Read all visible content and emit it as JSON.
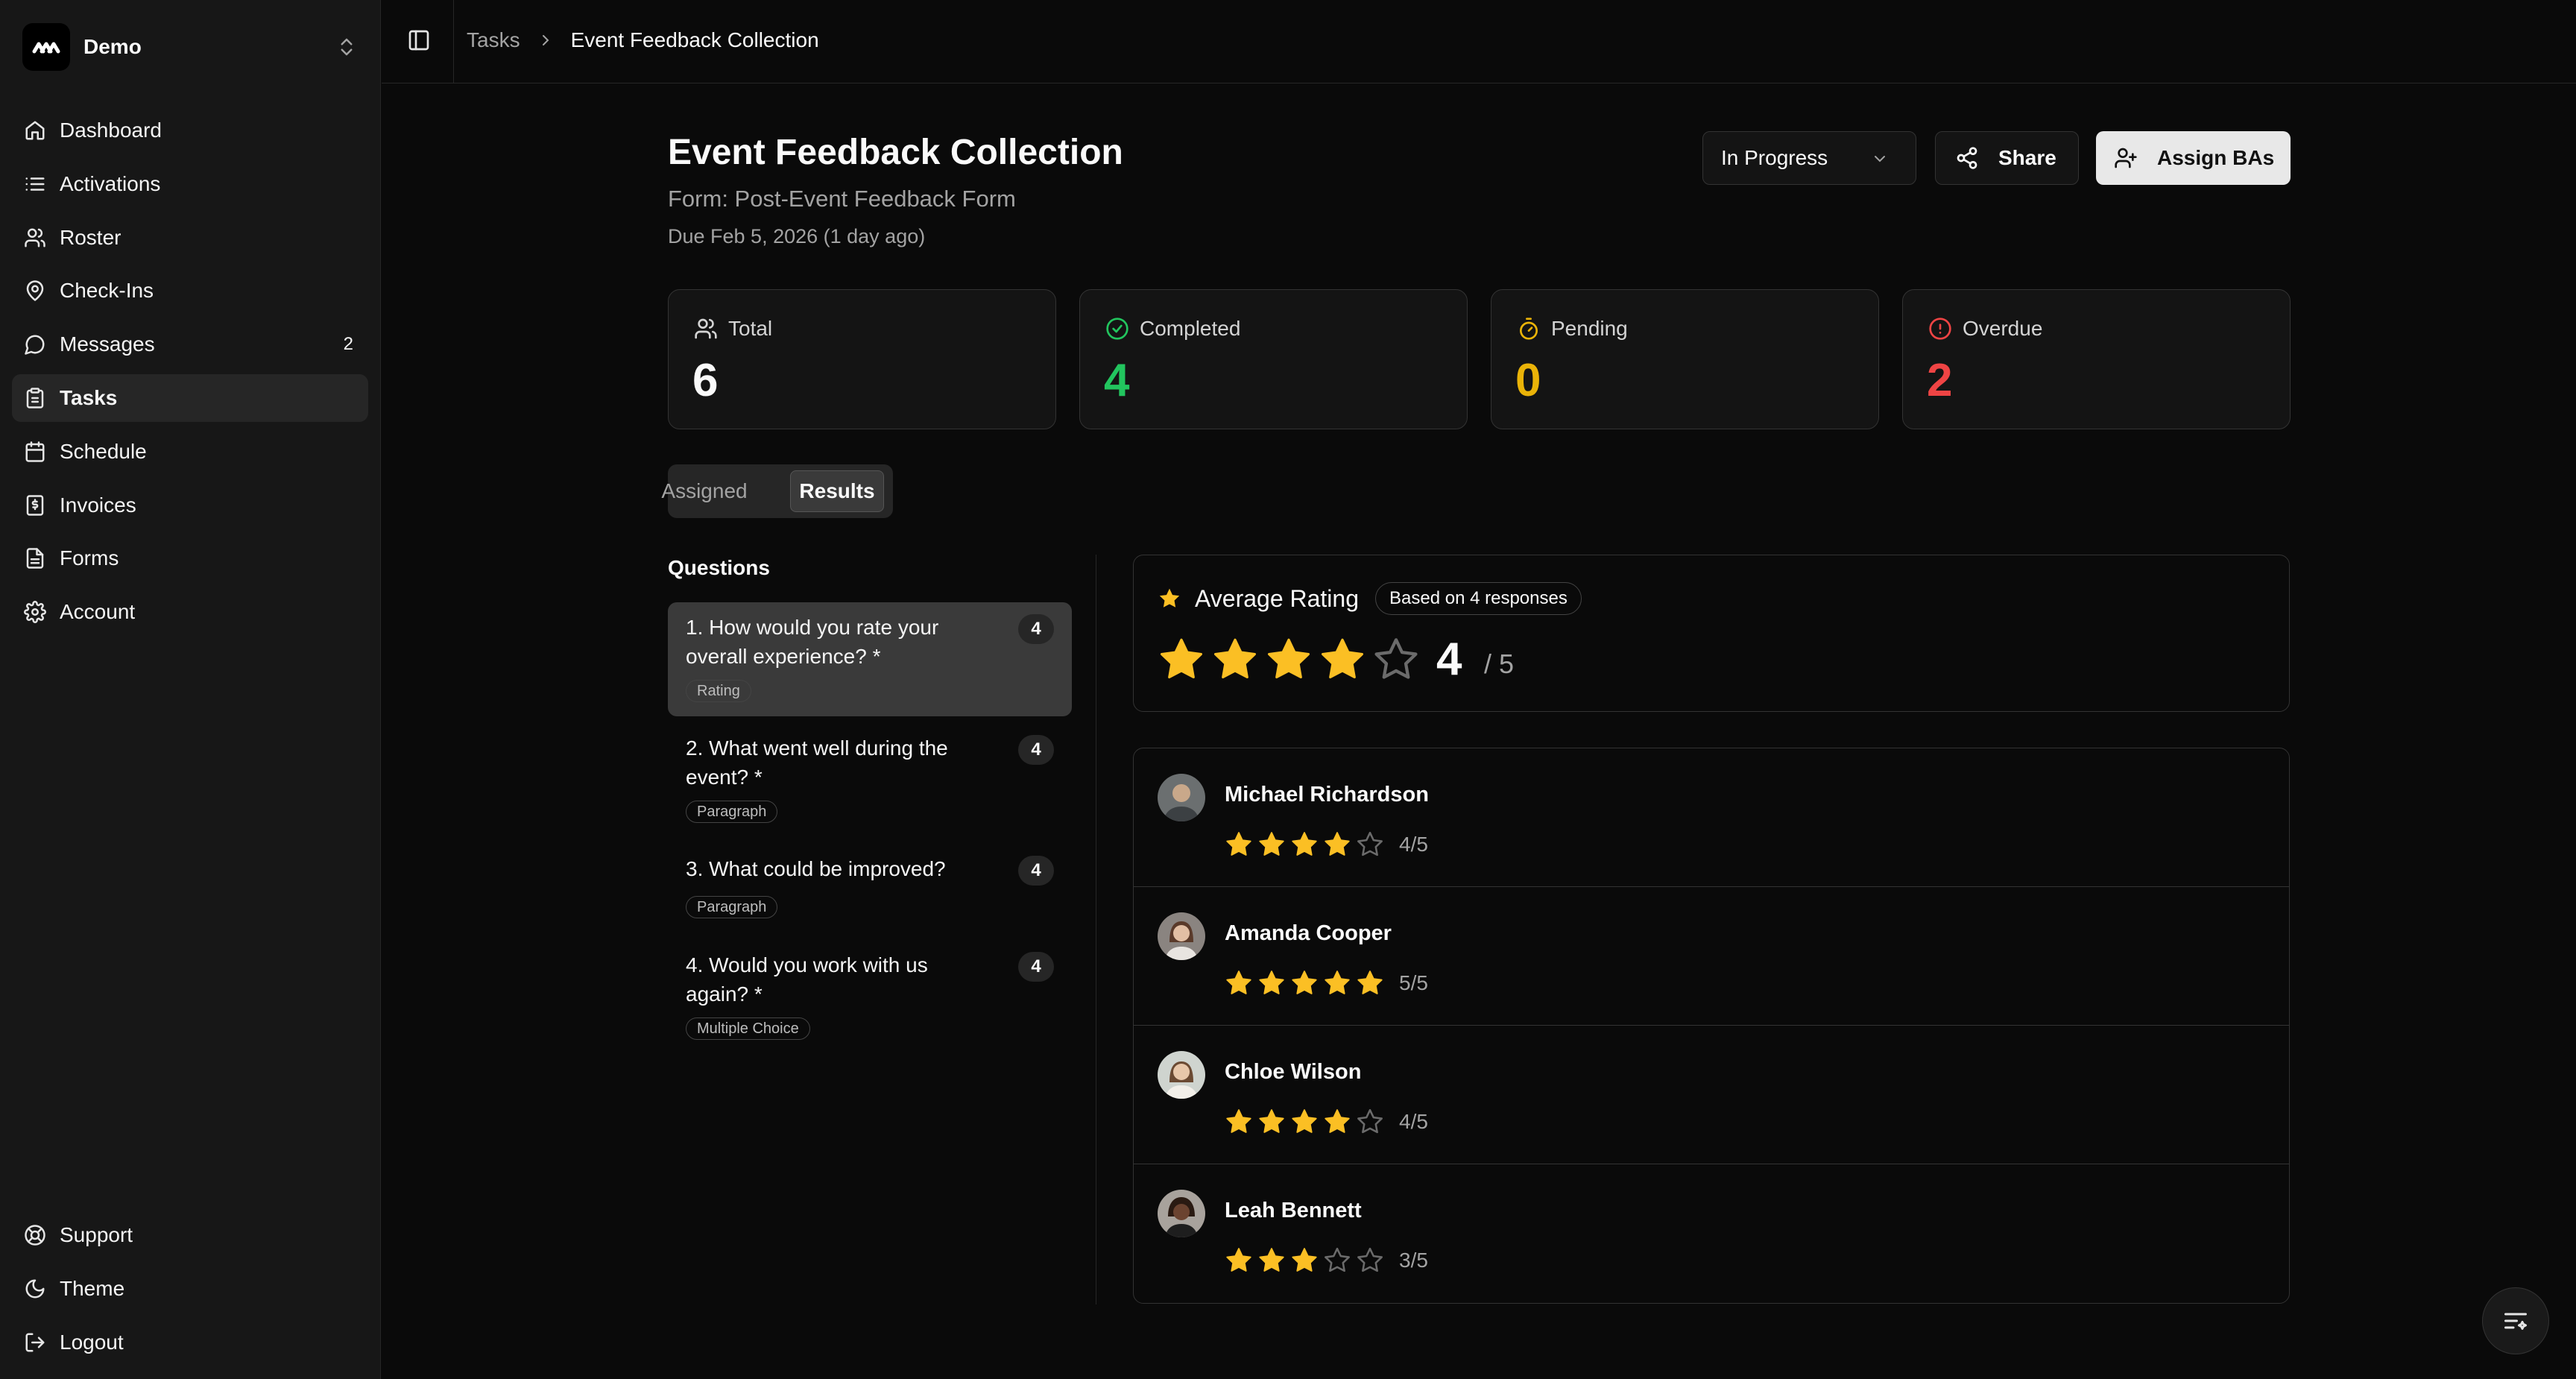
{
  "workspace": {
    "name": "Demo"
  },
  "nav": {
    "items": [
      {
        "label": "Dashboard",
        "icon": "home-icon"
      },
      {
        "label": "Activations",
        "icon": "list-icon"
      },
      {
        "label": "Roster",
        "icon": "users-icon"
      },
      {
        "label": "Check-Ins",
        "icon": "map-pin-icon"
      },
      {
        "label": "Messages",
        "icon": "message-icon",
        "count": "2"
      },
      {
        "label": "Tasks",
        "icon": "clipboard-icon",
        "active": true
      },
      {
        "label": "Schedule",
        "icon": "calendar-icon"
      },
      {
        "label": "Invoices",
        "icon": "receipt-icon"
      },
      {
        "label": "Forms",
        "icon": "file-icon"
      },
      {
        "label": "Account",
        "icon": "gear-icon"
      }
    ],
    "bottom": [
      {
        "label": "Support",
        "icon": "life-buoy-icon"
      },
      {
        "label": "Theme",
        "icon": "moon-icon"
      },
      {
        "label": "Logout",
        "icon": "logout-icon"
      }
    ]
  },
  "breadcrumb": {
    "parent": "Tasks",
    "current": "Event Feedback Collection"
  },
  "task": {
    "title": "Event Feedback Collection",
    "form": "Form: Post-Event Feedback Form",
    "due": "Due Feb 5, 2026 (1 day ago)",
    "status": "In Progress"
  },
  "actions": {
    "share": "Share",
    "assign": "Assign BAs"
  },
  "stats": [
    {
      "label": "Total",
      "value": "6",
      "color": "#fafafa",
      "icon": "users-icon"
    },
    {
      "label": "Completed",
      "value": "4",
      "color": "#22c55e",
      "icon": "check-circle-icon"
    },
    {
      "label": "Pending",
      "value": "0",
      "color": "#eab308",
      "icon": "timer-icon"
    },
    {
      "label": "Overdue",
      "value": "2",
      "color": "#ef4444",
      "icon": "alert-circle-icon"
    }
  ],
  "tabs": {
    "assigned": "Assigned",
    "results": "Results",
    "active": "results"
  },
  "questions": {
    "heading": "Questions",
    "items": [
      {
        "text": "1. How would you rate your overall experience? *",
        "count": "4",
        "type": "Rating"
      },
      {
        "text": "2. What went well during the event? *",
        "count": "4",
        "type": "Paragraph"
      },
      {
        "text": "3. What could be improved?",
        "count": "4",
        "type": "Paragraph"
      },
      {
        "text": "4. Would you work with us again? *",
        "count": "4",
        "type": "Multiple Choice"
      }
    ]
  },
  "average": {
    "title": "Average Rating",
    "pill": "Based on 4 responses",
    "value": "4",
    "max": "/ 5",
    "stars": 4
  },
  "responses": [
    {
      "name": "Michael Richardson",
      "rating": 4,
      "score": "4/5"
    },
    {
      "name": "Amanda Cooper",
      "rating": 5,
      "score": "5/5"
    },
    {
      "name": "Chloe Wilson",
      "rating": 4,
      "score": "4/5"
    },
    {
      "name": "Leah Bennett",
      "rating": 3,
      "score": "3/5"
    }
  ],
  "colors": {
    "accent": "#fbbf24",
    "bg": "#0a0a0a",
    "sidebar": "#171717"
  }
}
